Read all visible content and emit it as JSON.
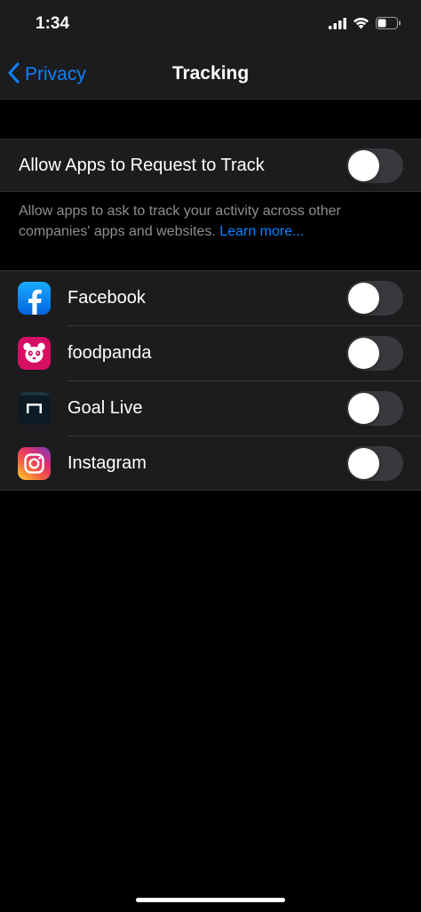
{
  "status_bar": {
    "time": "1:34",
    "icons": [
      "signal-icon",
      "wifi-icon",
      "battery-icon"
    ]
  },
  "nav": {
    "back_label": "Privacy",
    "title": "Tracking"
  },
  "allow_tracking": {
    "label": "Allow Apps to Request to Track",
    "enabled": false,
    "footer_text": "Allow apps to ask to track your activity across other companies' apps and websites. ",
    "footer_link": "Learn more..."
  },
  "apps": [
    {
      "name": "Facebook",
      "icon": "facebook-icon",
      "tracking_enabled": false
    },
    {
      "name": "foodpanda",
      "icon": "foodpanda-icon",
      "tracking_enabled": false
    },
    {
      "name": "Goal Live",
      "icon": "goal-live-icon",
      "tracking_enabled": false
    },
    {
      "name": "Instagram",
      "icon": "instagram-icon",
      "tracking_enabled": false
    }
  ],
  "colors": {
    "background": "#000000",
    "cell": "#1c1c1e",
    "accent": "#0a84ff",
    "toggle_off": "#39393d",
    "secondary_text": "#8e8e93"
  }
}
